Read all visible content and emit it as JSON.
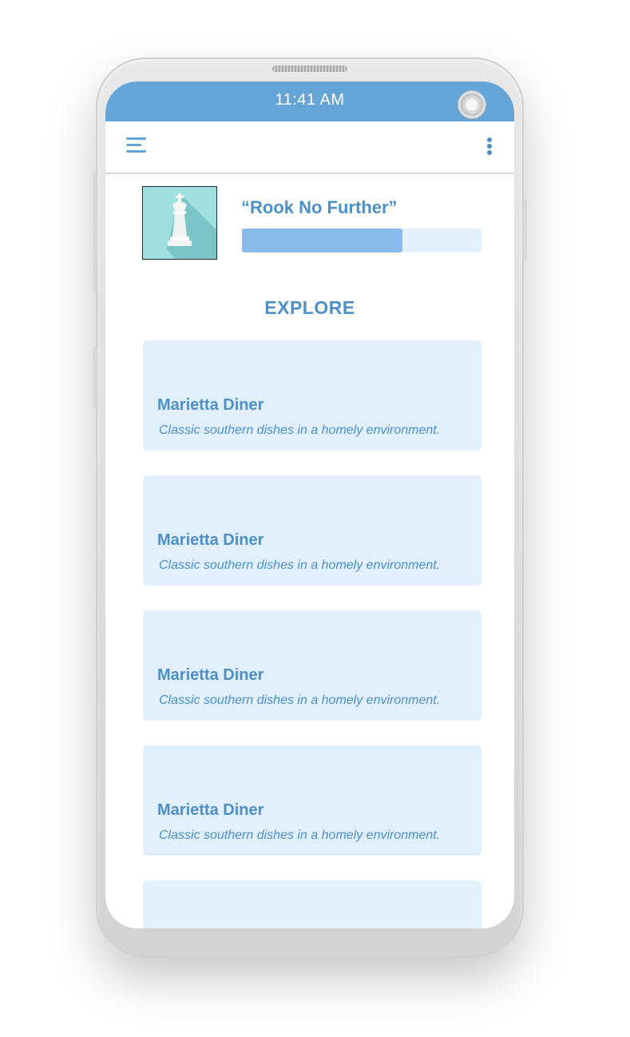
{
  "status_bar": {
    "time": "11:41 AM",
    "color": "#65a4d6"
  },
  "app_bar": {
    "menu_icon": "hamburger-menu-icon",
    "overflow_icon": "more-vertical-icon"
  },
  "profile": {
    "thumbnail_icon": "chess-king-piece-icon",
    "game_title": "“Rook No Further”",
    "progress_fraction": 0.67
  },
  "explore": {
    "heading": "EXPLORE",
    "cards": [
      {
        "title": "Marietta Diner",
        "description": "Classic southern dishes in a homely environment."
      },
      {
        "title": "Marietta Diner",
        "description": "Classic southern dishes in a homely environment."
      },
      {
        "title": "Marietta Diner",
        "description": "Classic southern dishes in a homely environment."
      },
      {
        "title": "Marietta Diner",
        "description": "Classic southern dishes in a homely environment."
      },
      {
        "title": "",
        "description": ""
      }
    ]
  },
  "colors": {
    "accent": "#4d8fc7",
    "card_background": "#e1f0fc",
    "progress_fill": "#86bbea"
  }
}
